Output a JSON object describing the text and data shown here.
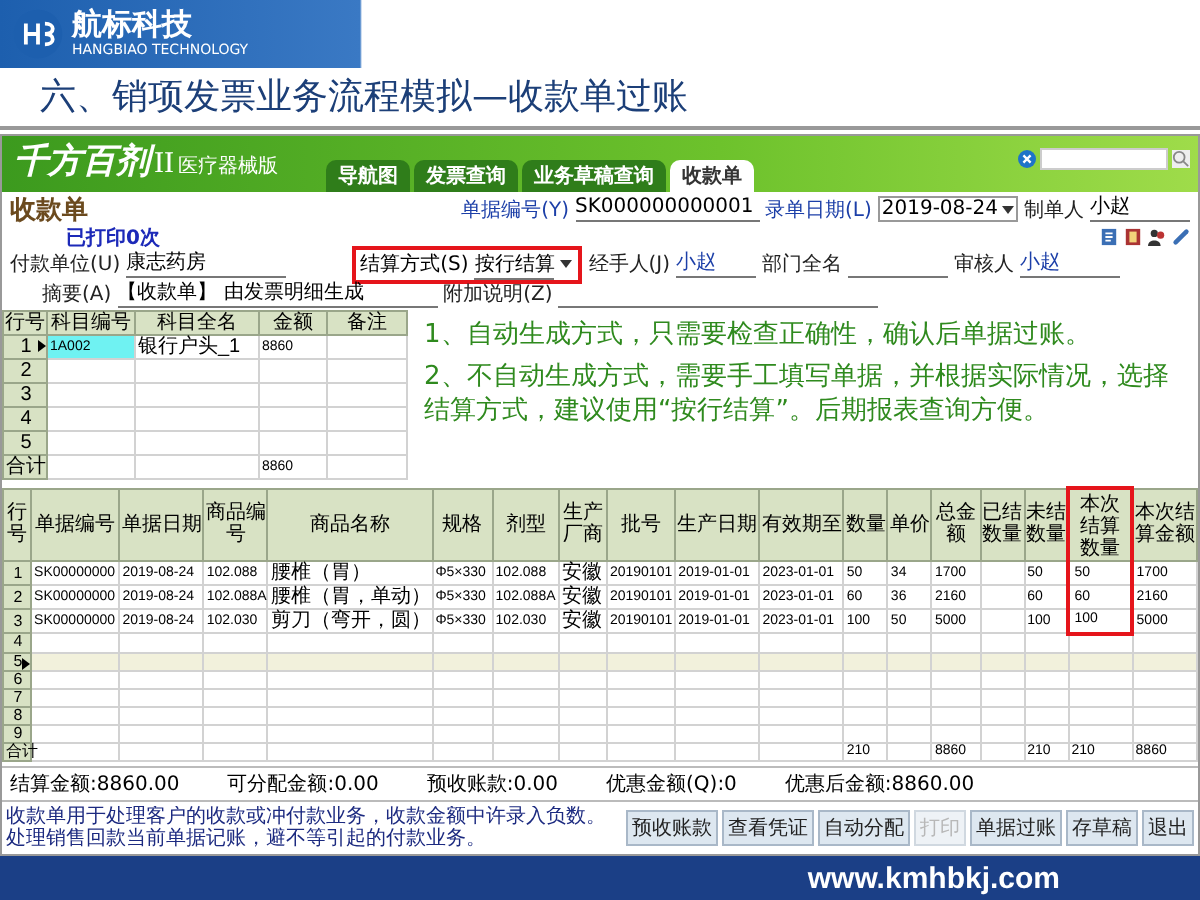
{
  "brand": {
    "name": "航标科技",
    "tagline": "HANGBIAO TECHNOLOGY"
  },
  "slide_title": "六、销项发票业务流程模拟—收款单过账",
  "app": {
    "logo": "千方百剂",
    "logo_suffix": "II",
    "edition": "医疗器械版",
    "tabs": [
      {
        "label": "导航图",
        "selected": false
      },
      {
        "label": "发票查询",
        "selected": false
      },
      {
        "label": "业务草稿查询",
        "selected": false
      },
      {
        "label": "收款单",
        "selected": true
      }
    ],
    "form": {
      "title": "收款单",
      "print_status": "已打印0次",
      "doc_no": {
        "label": "单据编号(Y)",
        "value": "SK000000000001"
      },
      "date": {
        "label": "录单日期(L)",
        "value": "2019-08-24"
      },
      "maker": {
        "label": "制单人",
        "value": "小赵"
      },
      "payer": {
        "label": "付款单位(U)",
        "value": "康志药房"
      },
      "settle": {
        "label": "结算方式(S)",
        "value": "按行结算",
        "highlighted": true
      },
      "handler": {
        "label": "经手人(J)",
        "value": "小赵"
      },
      "dept": {
        "label": "部门全名"
      },
      "auditor": {
        "label": "审核人",
        "value": "小赵"
      },
      "summary": {
        "label": "摘要(A)",
        "value": "【收款单】 由发票明细生成"
      },
      "note": {
        "label": "附加说明(Z)"
      }
    },
    "upper_table": {
      "columns": [
        "行号",
        "科目编号",
        "科目全名",
        "金额",
        "备注"
      ],
      "rows": [
        {
          "selected": true,
          "cells": [
            "1",
            "1A002",
            "银行户头_1",
            "8860",
            null
          ]
        },
        {
          "selected": false,
          "cells": [
            "2"
          ]
        },
        {
          "selected": false,
          "cells": [
            "3"
          ]
        },
        {
          "selected": false,
          "cells": [
            "4"
          ]
        },
        {
          "selected": false,
          "cells": [
            "5"
          ]
        }
      ],
      "total": {
        "cells": [
          "合计",
          null,
          null,
          "8860",
          null
        ]
      }
    },
    "notes": [
      "1、自动生成方式，只需要检查正确性，确认后单据过账。",
      "2、不自动生成方式，需要手工填写单据，并根据实际情况，选择结算方式，建议使用“按行结算”。后期报表查询方便。"
    ],
    "lower_table": {
      "columns": [
        {
          "label": "行号",
          "highlighted": false
        },
        {
          "label": "单据编号",
          "highlighted": false
        },
        {
          "label": "单据日期",
          "highlighted": false
        },
        {
          "label": "商品编号",
          "highlighted": false
        },
        {
          "label": "商品名称",
          "highlighted": false
        },
        {
          "label": "规格",
          "highlighted": false
        },
        {
          "label": "剂型",
          "highlighted": false
        },
        {
          "label": "生产厂商",
          "highlighted": false
        },
        {
          "label": "批号",
          "highlighted": false
        },
        {
          "label": "生产日期",
          "highlighted": false
        },
        {
          "label": "有效期至",
          "highlighted": false
        },
        {
          "label": "数量",
          "highlighted": false
        },
        {
          "label": "单价",
          "highlighted": false
        },
        {
          "label": "总金额",
          "highlighted": false
        },
        {
          "label": "已结数量",
          "highlighted": false
        },
        {
          "label": "未结数量",
          "highlighted": false
        },
        {
          "label": "本次结算数量",
          "highlighted": true
        },
        {
          "label": "本次结算金额",
          "highlighted": false
        }
      ],
      "rows": [
        {
          "selected": false,
          "cells": [
            "1",
            "SK00000000",
            "2019-08-24",
            "102.088",
            "腰椎（胃）",
            "Φ5×330",
            "102.088",
            "安徽",
            "20190101",
            "2019-01-01",
            "2023-01-01",
            "50",
            "34",
            "1700",
            null,
            "50",
            "50",
            "1700"
          ]
        },
        {
          "selected": false,
          "cells": [
            "2",
            "SK00000000",
            "2019-08-24",
            "102.088A",
            "腰椎（胃，单动）",
            "Φ5×330",
            "102.088A",
            "安徽",
            "20190101",
            "2019-01-01",
            "2023-01-01",
            "60",
            "36",
            "2160",
            null,
            "60",
            "60",
            "2160"
          ]
        },
        {
          "selected": false,
          "cells": [
            "3",
            "SK00000000",
            "2019-08-24",
            "102.030",
            "剪刀（弯开，圆）",
            "Φ5×330",
            "102.030",
            "安徽",
            "20190101",
            "2019-01-01",
            "2023-01-01",
            "100",
            "50",
            "5000",
            null,
            "100",
            "100",
            "5000"
          ]
        },
        {
          "selected": false,
          "cells": [
            "4"
          ]
        },
        {
          "selected": true,
          "cells": [
            "5"
          ]
        },
        {
          "selected": false,
          "cells": [
            "6"
          ]
        },
        {
          "selected": false,
          "cells": [
            "7"
          ]
        },
        {
          "selected": false,
          "cells": [
            "8"
          ]
        },
        {
          "selected": false,
          "cells": [
            "9"
          ]
        }
      ],
      "total": {
        "cells": [
          "合计",
          null,
          null,
          null,
          null,
          null,
          null,
          null,
          null,
          null,
          null,
          "210",
          null,
          "8860",
          null,
          "210",
          "210",
          "8860"
        ]
      }
    },
    "summary": [
      {
        "label": "结算金额:",
        "value": "8860.00"
      },
      {
        "label": "可分配金额:",
        "value": "0.00"
      },
      {
        "label": "预收账款:",
        "value": "0.00"
      },
      {
        "label": "优惠金额(Q):",
        "value": "0"
      },
      {
        "label": "优惠后金额:",
        "value": "8860.00"
      }
    ],
    "hint": [
      "收款单用于处理客户的收款或冲付款业务，收款金额中许录入负数。",
      "处理销售回款当前单据记账，避不等引起的付款业务。"
    ],
    "buttons": [
      {
        "label": "预收账款",
        "disabled": false
      },
      {
        "label": "查看凭证",
        "disabled": false
      },
      {
        "label": "自动分配",
        "disabled": false
      },
      {
        "label": "打印",
        "disabled": true
      },
      {
        "label": "单据过账",
        "disabled": false
      },
      {
        "label": "存草稿",
        "disabled": false
      },
      {
        "label": "退出",
        "disabled": false
      }
    ]
  },
  "footer": {
    "url": "www.kmhbkj.com"
  }
}
